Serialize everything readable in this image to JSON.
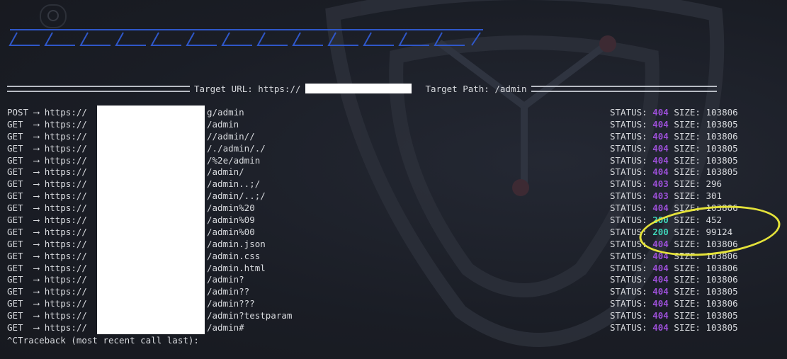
{
  "header": {
    "target_url_label": "Target URL: https://",
    "target_path_label": "Target Path: /admin"
  },
  "requests": [
    {
      "method": "POST",
      "arrow": "⟶",
      "scheme": "https://",
      "path": "g/admin",
      "status_label": "STATUS:",
      "status": "404",
      "size_label": "SIZE:",
      "size": "103806"
    },
    {
      "method": "GET",
      "arrow": "⟶",
      "scheme": "https://",
      "path": "/admin",
      "status_label": "STATUS:",
      "status": "404",
      "size_label": "SIZE:",
      "size": "103805"
    },
    {
      "method": "GET",
      "arrow": "⟶",
      "scheme": "https://",
      "path": "//admin//",
      "status_label": "STATUS:",
      "status": "404",
      "size_label": "SIZE:",
      "size": "103806"
    },
    {
      "method": "GET",
      "arrow": "⟶",
      "scheme": "https://",
      "path": "/./admin/./",
      "status_label": "STATUS:",
      "status": "404",
      "size_label": "SIZE:",
      "size": "103805"
    },
    {
      "method": "GET",
      "arrow": "⟶",
      "scheme": "https://",
      "path": "/%2e/admin",
      "status_label": "STATUS:",
      "status": "404",
      "size_label": "SIZE:",
      "size": "103805"
    },
    {
      "method": "GET",
      "arrow": "⟶",
      "scheme": "https://",
      "path": "/admin/",
      "status_label": "STATUS:",
      "status": "404",
      "size_label": "SIZE:",
      "size": "103805"
    },
    {
      "method": "GET",
      "arrow": "⟶",
      "scheme": "https://",
      "path": "/admin..;/",
      "status_label": "STATUS:",
      "status": "403",
      "size_label": "SIZE:",
      "size": "296"
    },
    {
      "method": "GET",
      "arrow": "⟶",
      "scheme": "https://",
      "path": "/admin/..;/",
      "status_label": "STATUS:",
      "status": "403",
      "size_label": "SIZE:",
      "size": "301"
    },
    {
      "method": "GET",
      "arrow": "⟶",
      "scheme": "https://",
      "path": "/admin%20",
      "status_label": "STATUS:",
      "status": "404",
      "size_label": "SIZE:",
      "size": "103806"
    },
    {
      "method": "GET",
      "arrow": "⟶",
      "scheme": "https://",
      "path": "/admin%09",
      "status_label": "STATUS:",
      "status": "200",
      "size_label": "SIZE:",
      "size": "452"
    },
    {
      "method": "GET",
      "arrow": "⟶",
      "scheme": "https://",
      "path": "/admin%00",
      "status_label": "STATUS:",
      "status": "200",
      "size_label": "SIZE:",
      "size": "99124"
    },
    {
      "method": "GET",
      "arrow": "⟶",
      "scheme": "https://",
      "path": "/admin.json",
      "status_label": "STATUS:",
      "status": "404",
      "size_label": "SIZE:",
      "size": "103806"
    },
    {
      "method": "GET",
      "arrow": "⟶",
      "scheme": "https://",
      "path": "/admin.css",
      "status_label": "STATUS:",
      "status": "404",
      "size_label": "SIZE:",
      "size": "103806"
    },
    {
      "method": "GET",
      "arrow": "⟶",
      "scheme": "https://",
      "path": "/admin.html",
      "status_label": "STATUS:",
      "status": "404",
      "size_label": "SIZE:",
      "size": "103806"
    },
    {
      "method": "GET",
      "arrow": "⟶",
      "scheme": "https://",
      "path": "/admin?",
      "status_label": "STATUS:",
      "status": "404",
      "size_label": "SIZE:",
      "size": "103806"
    },
    {
      "method": "GET",
      "arrow": "⟶",
      "scheme": "https://",
      "path": "/admin??",
      "status_label": "STATUS:",
      "status": "404",
      "size_label": "SIZE:",
      "size": "103805"
    },
    {
      "method": "GET",
      "arrow": "⟶",
      "scheme": "https://",
      "path": "/admin???",
      "status_label": "STATUS:",
      "status": "404",
      "size_label": "SIZE:",
      "size": "103806"
    },
    {
      "method": "GET",
      "arrow": "⟶",
      "scheme": "https://",
      "path": "/admin?testparam",
      "status_label": "STATUS:",
      "status": "404",
      "size_label": "SIZE:",
      "size": "103805"
    },
    {
      "method": "GET",
      "arrow": "⟶",
      "scheme": "https://",
      "path": "/admin#",
      "status_label": "STATUS:",
      "status": "404",
      "size_label": "SIZE:",
      "size": "103805"
    }
  ],
  "footer": {
    "traceback": "^CTraceback (most recent call last):"
  },
  "colors": {
    "status_4xx": "#9b4fd6",
    "status_200": "#3fd3b8",
    "highlight": "#e4e23a",
    "banner": "#2f57c9"
  },
  "icons": {
    "watermark": "shield-logo-icon",
    "tab": "tab-icon"
  }
}
